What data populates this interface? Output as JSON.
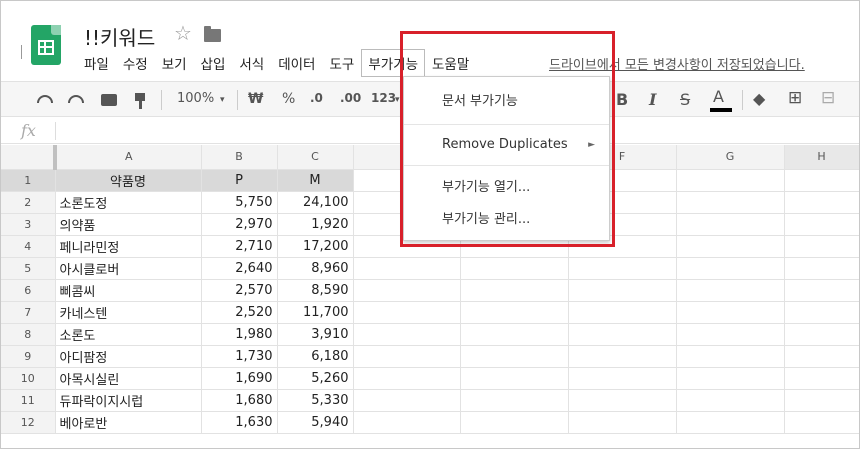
{
  "app": {
    "title": "!!키워드",
    "star_icon": "star-icon",
    "folder_icon": "folder-icon",
    "save_status": "드라이브에서 모든 변경사항이 저장되었습니다."
  },
  "menu": {
    "items": [
      {
        "label": "파일"
      },
      {
        "label": "수정"
      },
      {
        "label": "보기"
      },
      {
        "label": "삽입"
      },
      {
        "label": "서식"
      },
      {
        "label": "데이터"
      },
      {
        "label": "도구"
      },
      {
        "label": "부가기능"
      },
      {
        "label": "도움말"
      }
    ],
    "active_index": 7
  },
  "toolbar": {
    "zoom": "100%",
    "zoom_arrow": "▾",
    "currency": "₩",
    "percent": "%",
    "decimal_decrease": ".0",
    "decimal_increase": ".00",
    "more_formats": "123",
    "more_formats_arrow": "▾",
    "bold": "B",
    "italic": "I",
    "strike": "S",
    "font_color": "A",
    "font_color_value": "#000000"
  },
  "formula_bar": {
    "fx": "fx",
    "value": ""
  },
  "dropdown": {
    "items": [
      {
        "label": "문서 부가기능",
        "submenu": false
      },
      {
        "label": "Remove Duplicates",
        "submenu": true
      },
      {
        "label": "부가기능 열기...",
        "submenu": false
      },
      {
        "label": "부가기능 관리...",
        "submenu": false
      }
    ],
    "submenu_arrow": "►",
    "highlight_color": "#d8202a"
  },
  "sheet": {
    "columns": [
      "A",
      "B",
      "C",
      "",
      "",
      "F",
      "G",
      "H"
    ],
    "header_row": {
      "row": "1",
      "name": "약품명",
      "p": "P",
      "m": "M"
    },
    "rows": [
      {
        "row": "2",
        "name": "소론도정",
        "p": "5,750",
        "m": "24,100"
      },
      {
        "row": "3",
        "name": "의약품",
        "p": "2,970",
        "m": "1,920"
      },
      {
        "row": "4",
        "name": "페니라민정",
        "p": "2,710",
        "m": "17,200"
      },
      {
        "row": "5",
        "name": "아시클로버",
        "p": "2,640",
        "m": "8,960"
      },
      {
        "row": "6",
        "name": "삐콤씨",
        "p": "2,570",
        "m": "8,590"
      },
      {
        "row": "7",
        "name": "카네스텐",
        "p": "2,520",
        "m": "11,700"
      },
      {
        "row": "8",
        "name": "소론도",
        "p": "1,980",
        "m": "3,910"
      },
      {
        "row": "9",
        "name": "아디팜정",
        "p": "1,730",
        "m": "6,180"
      },
      {
        "row": "10",
        "name": "아목시실린",
        "p": "1,690",
        "m": "5,260"
      },
      {
        "row": "11",
        "name": "듀파락이지시럽",
        "p": "1,680",
        "m": "5,330"
      },
      {
        "row": "12",
        "name": "베아로반",
        "p": "1,630",
        "m": "5,940"
      }
    ]
  }
}
